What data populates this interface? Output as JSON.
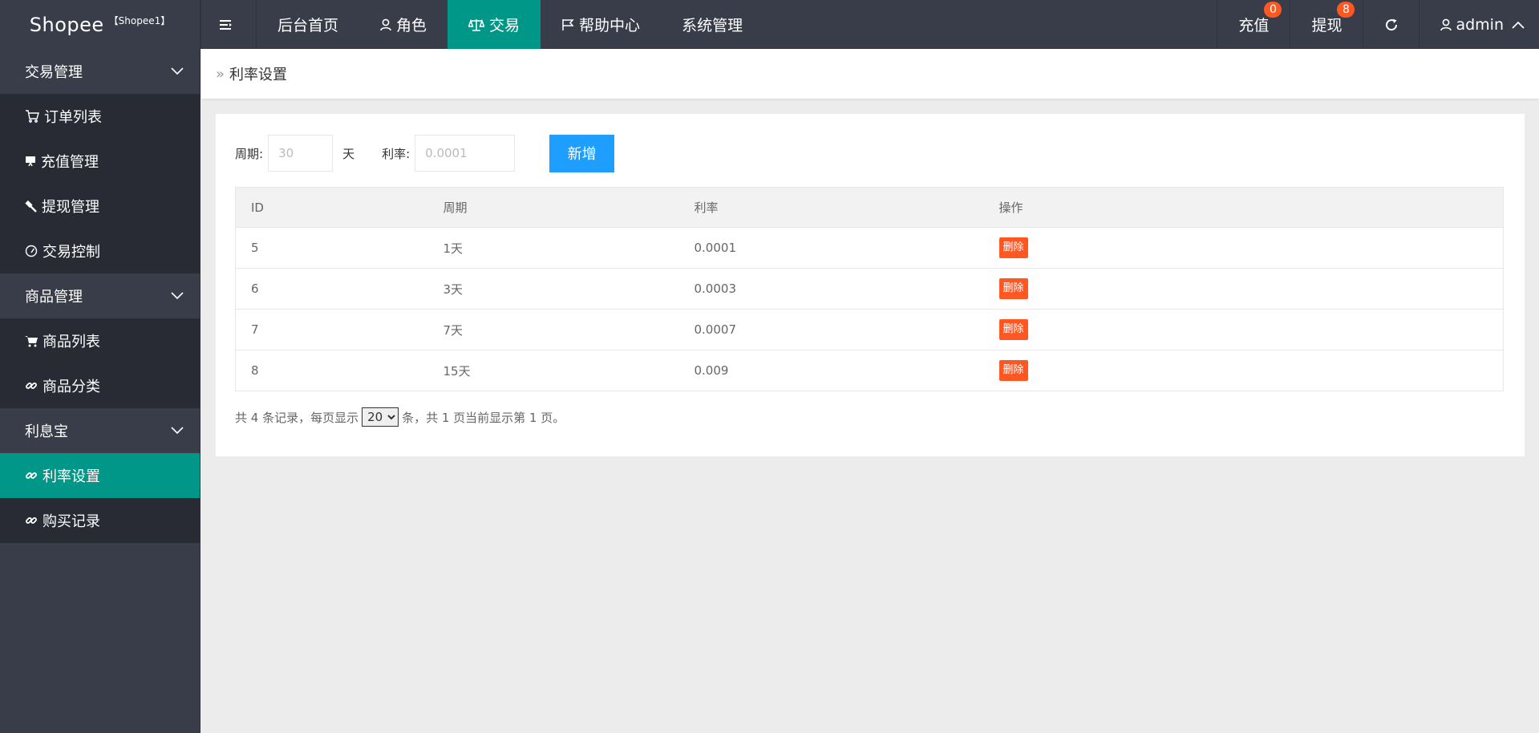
{
  "header": {
    "brand": "Shopee",
    "brand_tag": "【Shopee1】",
    "nav": [
      {
        "label": "后台首页"
      },
      {
        "label": "角色"
      },
      {
        "label": "交易"
      },
      {
        "label": "帮助中心"
      },
      {
        "label": "系统管理"
      }
    ],
    "recharge_label": "充值",
    "recharge_badge": "0",
    "withdraw_label": "提现",
    "withdraw_badge": "8",
    "user_label": "admin",
    "accent_color": "#009688",
    "badge_color": "#ff5722"
  },
  "sidebar": {
    "groups": [
      {
        "label": "交易管理",
        "items": [
          {
            "label": "订单列表",
            "icon": "cart-icon"
          },
          {
            "label": "充值管理",
            "icon": "monitor-icon"
          },
          {
            "label": "提现管理",
            "icon": "hammer-icon"
          },
          {
            "label": "交易控制",
            "icon": "dashboard-icon"
          }
        ]
      },
      {
        "label": "商品管理",
        "items": [
          {
            "label": "商品列表",
            "icon": "cart-icon"
          },
          {
            "label": "商品分类",
            "icon": "link-icon"
          }
        ]
      },
      {
        "label": "利息宝",
        "items": [
          {
            "label": "利率设置",
            "icon": "link-icon",
            "active": true
          },
          {
            "label": "购买记录",
            "icon": "link-icon"
          }
        ]
      }
    ]
  },
  "breadcrumb": {
    "current": "利率设置"
  },
  "form": {
    "period_label": "周期:",
    "period_placeholder": "30",
    "period_unit": "天",
    "rate_label": "利率:",
    "rate_placeholder": "0.0001",
    "add_button": "新增"
  },
  "table": {
    "columns": [
      "ID",
      "周期",
      "利率",
      "操作"
    ],
    "rows": [
      {
        "id": "5",
        "period": "1天",
        "rate": "0.0001",
        "action": "删除"
      },
      {
        "id": "6",
        "period": "3天",
        "rate": "0.0003",
        "action": "删除"
      },
      {
        "id": "7",
        "period": "7天",
        "rate": "0.0007",
        "action": "删除"
      },
      {
        "id": "8",
        "period": "15天",
        "rate": "0.009",
        "action": "删除"
      }
    ]
  },
  "pager": {
    "prefix": "共 4 条记录，每页显示",
    "page_size": "20",
    "suffix": "条，共 1 页当前显示第 1 页。"
  }
}
